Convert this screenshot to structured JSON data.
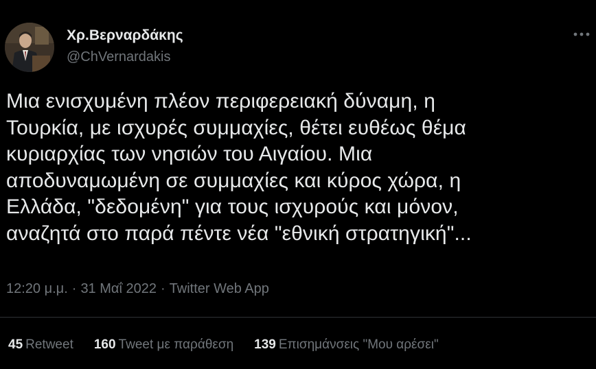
{
  "author": {
    "display_name": "Χρ.Βερναρδάκης",
    "handle": "@ChVernardakis"
  },
  "tweet": {
    "text": "Μια ενισχυμένη πλέον περιφερειακή δύναμη, η\nΤουρκία, με ισχυρές συμμαχίες, θέτει ευθέως θέμα\nκυριαρχίας των νησιών του Αιγαίου. Μια\nαποδυναμωμένη σε συμμαχίες και κύρος χώρα, η\nΕλλάδα, \"δεδομένη\" για τους ισχυρούς και μόνον,\nαναζητά στο παρά πέντε νέα \"εθνική στρατηγική\"...",
    "time": "12:20 μ.μ.",
    "separator": "·",
    "date": "31 Μαΐ 2022",
    "source": "Twitter Web App"
  },
  "stats": {
    "retweets": {
      "count": "45",
      "label": "Retweet"
    },
    "quotes": {
      "count": "160",
      "label": "Tweet με παράθεση"
    },
    "likes": {
      "count": "139",
      "label": "Επισημάνσεις \"Μου αρέσει\""
    }
  },
  "icons": {
    "more": "more-horizontal-icon"
  },
  "colors": {
    "background": "#000000",
    "text": "#e7e9ea",
    "muted": "#71767b",
    "divider": "#2f3336"
  }
}
